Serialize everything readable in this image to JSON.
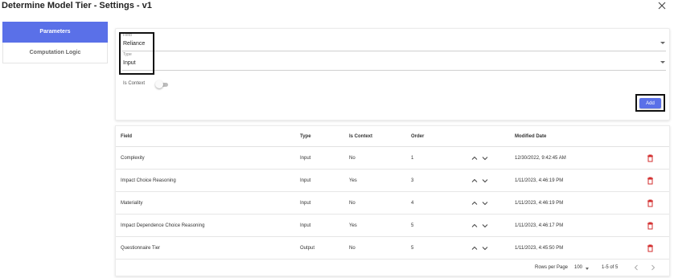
{
  "window": {
    "title": "Determine Model Tier - Settings - v1"
  },
  "nav": {
    "items": [
      {
        "label": "Parameters",
        "active": true
      },
      {
        "label": "Computation Logic",
        "active": false
      }
    ]
  },
  "form": {
    "field": {
      "label": "Field",
      "value": "Reliance"
    },
    "type": {
      "label": "Type",
      "value": "Input"
    },
    "is_context": {
      "label": "Is Context",
      "checked": false
    },
    "add_label": "Add"
  },
  "table": {
    "headers": {
      "field": "Field",
      "type": "Type",
      "context": "Is Context",
      "order": "Order",
      "date": "Modified Date"
    },
    "rows": [
      {
        "field": "Complexity",
        "type": "Input",
        "context": "No",
        "order": "1",
        "date": "12/30/2022, 9:42:45 AM"
      },
      {
        "field": "Impact Choice Reasoning",
        "type": "Input",
        "context": "Yes",
        "order": "3",
        "date": "1/11/2023, 4:46:19 PM"
      },
      {
        "field": "Materiality",
        "type": "Input",
        "context": "No",
        "order": "4",
        "date": "1/11/2023, 4:46:19 PM"
      },
      {
        "field": "Impact Dependence Choice Reasoning",
        "type": "Input",
        "context": "Yes",
        "order": "5",
        "date": "1/11/2023, 4:46:17 PM"
      },
      {
        "field": "Questionnaire Tier",
        "type": "Output",
        "context": "No",
        "order": "5",
        "date": "1/11/2023, 4:45:50 PM"
      }
    ]
  },
  "pagination": {
    "rows_per_page_label": "Rows per Page",
    "rows_per_page_value": "100",
    "range": "1-5 of 5"
  },
  "colors": {
    "accent": "#5a70e8",
    "delete": "#d32f2f"
  },
  "icons": {
    "close": "close-icon",
    "up": "chevron-up-icon",
    "down": "chevron-down-icon",
    "delete": "trash-icon",
    "prev": "chevron-left-icon",
    "next": "chevron-right-icon"
  }
}
